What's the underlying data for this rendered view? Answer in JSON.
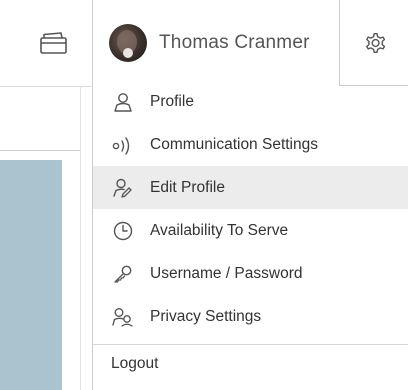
{
  "user": {
    "name": "Thomas Cranmer"
  },
  "menu": {
    "items": [
      {
        "label": "Profile",
        "icon": "person-outline-icon",
        "active": false
      },
      {
        "label": "Communication Settings",
        "icon": "broadcast-signal-icon",
        "active": false
      },
      {
        "label": "Edit Profile",
        "icon": "person-edit-icon",
        "active": true
      },
      {
        "label": "Availability To Serve",
        "icon": "clock-icon",
        "active": false
      },
      {
        "label": "Username / Password",
        "icon": "key-icon",
        "active": false
      },
      {
        "label": "Privacy Settings",
        "icon": "privacy-people-icon",
        "active": false
      }
    ],
    "logout_label": "Logout"
  },
  "colors": {
    "active_row": "#ececec",
    "side_panel": "#a9c4cf",
    "text": "#333333",
    "icon": "#555555"
  }
}
